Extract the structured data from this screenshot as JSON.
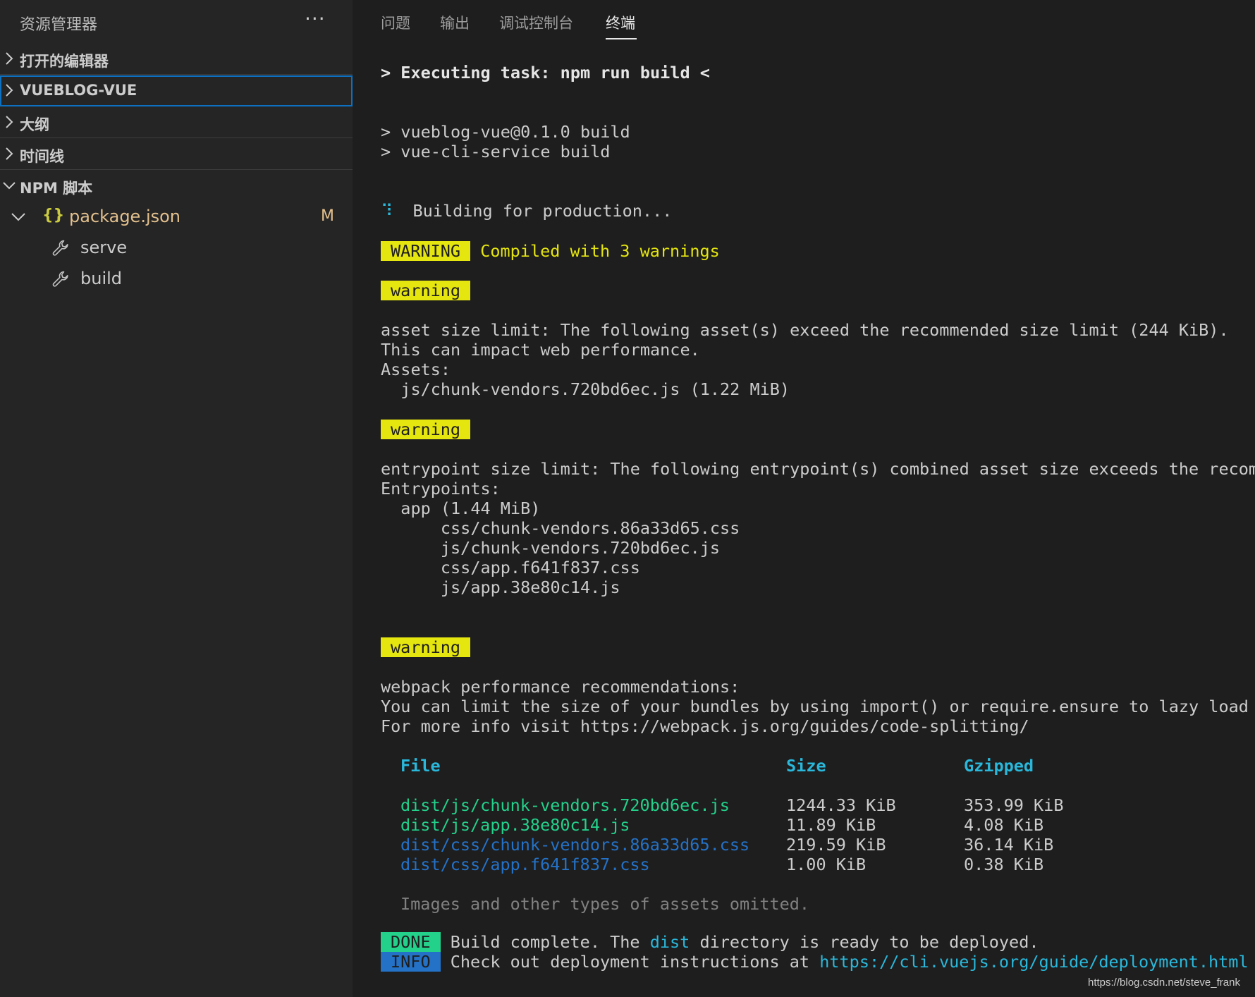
{
  "explorer": {
    "title": "资源管理器",
    "more_label": "···",
    "sections": [
      {
        "label": "打开的编辑器",
        "expanded": false
      },
      {
        "label": "VUEBLOG-VUE",
        "expanded": false,
        "focused": true
      },
      {
        "label": "大纲",
        "expanded": false
      },
      {
        "label": "时间线",
        "expanded": false
      },
      {
        "label": "NPM 脚本",
        "expanded": true
      }
    ],
    "npm": {
      "file_icon": "{}",
      "file_label": "package.json",
      "file_badge": "M",
      "scripts": [
        {
          "label": "serve",
          "icon": "wrench-icon"
        },
        {
          "label": "build",
          "icon": "wrench-icon"
        }
      ]
    }
  },
  "panel": {
    "tabs": [
      {
        "label": "问题",
        "active": false
      },
      {
        "label": "输出",
        "active": false
      },
      {
        "label": "调试控制台",
        "active": false
      },
      {
        "label": "终端",
        "active": true
      }
    ]
  },
  "terminal": {
    "task_line": "> Executing task: npm run build <",
    "cmd_lines": [
      "> vueblog-vue@0.1.0 build",
      "> vue-cli-service build"
    ],
    "spinner": "⠹",
    "building": "Building for production...",
    "warning_badge_caps": "WARNING",
    "compiled_msg": "Compiled with 3 warnings",
    "warning_badge": "warning",
    "asset_block": [
      "asset size limit: The following asset(s) exceed the recommended size limit (244 KiB).",
      "This can impact web performance.",
      "Assets:",
      "  js/chunk-vendors.720bd6ec.js (1.22 MiB)"
    ],
    "entry_block": [
      "entrypoint size limit: The following entrypoint(s) combined asset size exceeds the recomm",
      "Entrypoints:",
      "  app (1.44 MiB)",
      "      css/chunk-vendors.86a33d65.css",
      "      js/chunk-vendors.720bd6ec.js",
      "      css/app.f641f837.css",
      "      js/app.38e80c14.js"
    ],
    "perf_block": [
      "webpack performance recommendations:",
      "You can limit the size of your bundles by using import() or require.ensure to lazy load s",
      "For more info visit https://webpack.js.org/guides/code-splitting/"
    ],
    "table": {
      "headers": {
        "file": "File",
        "size": "Size",
        "gzipped": "Gzipped"
      },
      "rows": [
        {
          "file": "dist/js/chunk-vendors.720bd6ec.js",
          "size": "1244.33 KiB",
          "gzipped": "353.99 KiB",
          "kind": "js"
        },
        {
          "file": "dist/js/app.38e80c14.js",
          "size": "11.89 KiB",
          "gzipped": "4.08 KiB",
          "kind": "js"
        },
        {
          "file": "dist/css/chunk-vendors.86a33d65.css",
          "size": "219.59 KiB",
          "gzipped": "36.14 KiB",
          "kind": "css"
        },
        {
          "file": "dist/css/app.f641f837.css",
          "size": "1.00 KiB",
          "gzipped": "0.38 KiB",
          "kind": "css"
        }
      ]
    },
    "omitted": "Images and other types of assets omitted.",
    "done_badge": "DONE",
    "done_text_before": "Build complete. The ",
    "done_dist": "dist",
    "done_text_after": " directory is ready to be deployed.",
    "info_badge": "INFO",
    "info_text": "Check out deployment instructions at ",
    "info_link": "https://cli.vuejs.org/guide/deployment.html"
  },
  "watermark": "https://blog.csdn.net/steve_frank",
  "colors": {
    "sidebar_bg": "#252526",
    "panel_bg": "#1e1e1e",
    "focus_border": "#0e70c0",
    "warning_yellow": "#e5e510",
    "ansi_green": "#23d18b",
    "ansi_blue": "#2472c8",
    "ansi_cyan": "#29b8db",
    "modified": "#e2c08d"
  }
}
